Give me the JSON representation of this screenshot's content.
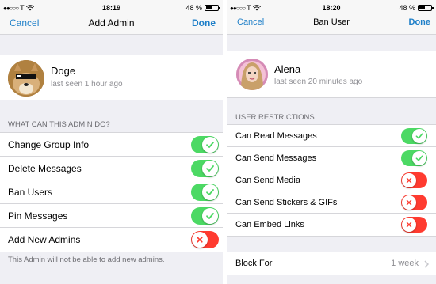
{
  "left": {
    "status": {
      "carrier": "T",
      "time": "18:19",
      "battery": "48 %",
      "battery_level": 0.48
    },
    "nav": {
      "cancel": "Cancel",
      "title": "Add Admin",
      "done": "Done"
    },
    "profile": {
      "name": "Doge",
      "status": "last seen 1 hour ago"
    },
    "section_header": "WHAT CAN THIS ADMIN DO?",
    "permissions": [
      {
        "label": "Change Group Info",
        "enabled": true
      },
      {
        "label": "Delete Messages",
        "enabled": true
      },
      {
        "label": "Ban Users",
        "enabled": true
      },
      {
        "label": "Pin Messages",
        "enabled": true
      },
      {
        "label": "Add New Admins",
        "enabled": false
      }
    ],
    "footer": "This Admin will not be able to add new admins."
  },
  "right": {
    "status": {
      "carrier": "T",
      "time": "18:20",
      "battery": "48 %",
      "battery_level": 0.48
    },
    "nav": {
      "cancel": "Cancel",
      "title": "Ban User",
      "done": "Done"
    },
    "profile": {
      "name": "Alena",
      "status": "last seen 20 minutes ago"
    },
    "section_header": "USER RESTRICTIONS",
    "restrictions": [
      {
        "label": "Can Read Messages",
        "enabled": true
      },
      {
        "label": "Can Send Messages",
        "enabled": true
      },
      {
        "label": "Can Send Media",
        "enabled": false
      },
      {
        "label": "Can Send Stickers & GIFs",
        "enabled": false
      },
      {
        "label": "Can Embed Links",
        "enabled": false
      }
    ],
    "block_for": {
      "label": "Block For",
      "value": "1 week"
    }
  },
  "colors": {
    "accent": "#1e7fc8",
    "toggle_on": "#4cd964",
    "toggle_off": "#ff3b30"
  },
  "icons": {
    "signal": "signal-dots-icon",
    "wifi": "wifi-icon",
    "battery": "battery-icon",
    "check": "check-icon",
    "cross": "cross-icon",
    "chevron": "chevron-right-icon"
  }
}
